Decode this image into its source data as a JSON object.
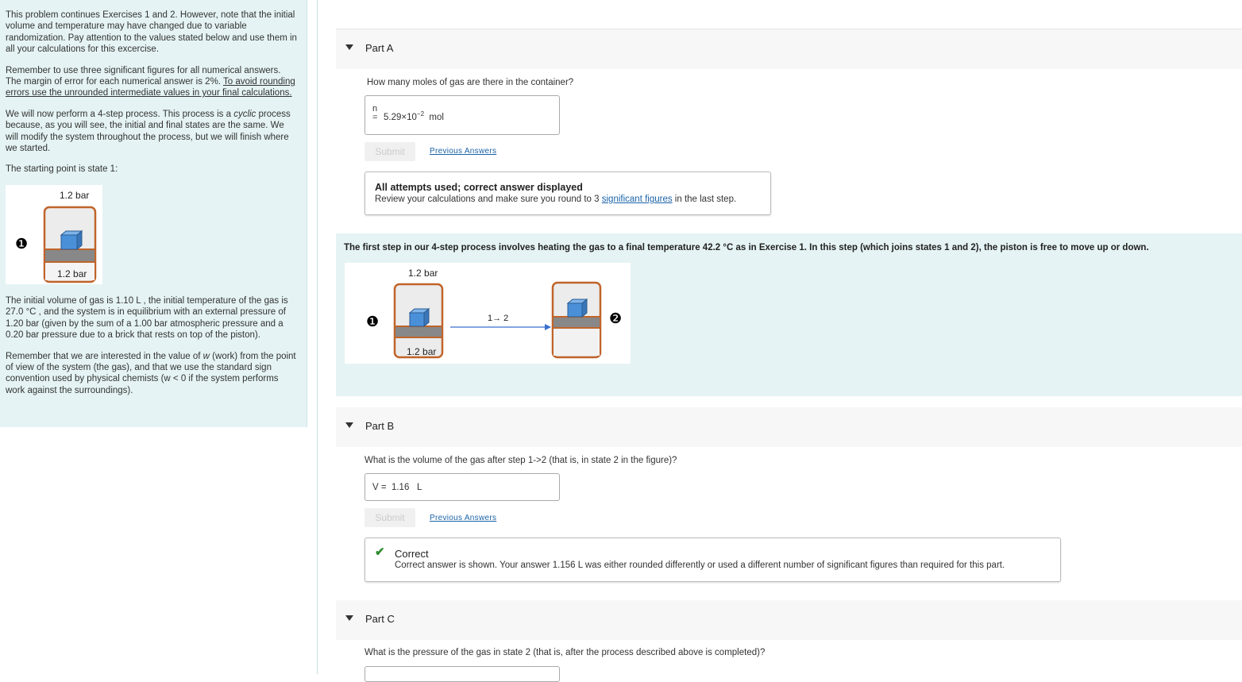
{
  "left": {
    "p1": "This problem continues Exercises 1 and 2. However, note that the initial volume and temperature may have changed due to variable randomization. Pay attention to the values stated below and use them in all your calculations for this excercise.",
    "p2_a": "Remember to use three significant figures for all numerical answers. The margin of error for each numerical answer is 2%. ",
    "p2_link": "To avoid rounding errors use the unrounded intermediate values in your final calculations.",
    "p3_a": "We will now perform a 4-step process. This process is a ",
    "p3_em": "cyclic",
    "p3_b": " process because, as you will see, the initial and final states are the same. We will modify the system throughout the process, but we will finish where we started.",
    "p4": "The starting point is state 1:",
    "fig_top_label": "1.2 bar",
    "fig_bottom_label": "1.2 bar",
    "state_marker": "❶",
    "p5": "The initial volume of gas is  1.10 L , the initial temperature of the gas is  27.0 °C , and the system is in equilibrium with an external pressure of 1.20 bar (given by the sum of a 1.00 bar atmospheric pressure and a 0.20 bar pressure due to a brick that rests on top of the piston).",
    "p6_a": "Remember that we are interested in the value of ",
    "p6_em": "w",
    "p6_b": " (work) from the point of view of the system (the gas), and that we use the standard sign convention used by physical chemists (w < 0 if the system performs work against the surroundings)."
  },
  "partA": {
    "title": "Part A",
    "question": "How many moles of gas are there in the container?",
    "var": "n",
    "eq": "=",
    "value_base": "5.29×10",
    "value_exp": "−2",
    "unit": "mol",
    "submit": "Submit",
    "prev": "Previous Answers",
    "fb_title": "All attempts used; correct answer displayed",
    "fb_a": "Review your calculations and make sure you round to 3 ",
    "fb_link": "significant figures",
    "fb_b": " in the last step."
  },
  "step": {
    "text": "The first step in our 4-step process involves heating the gas to a final temperature  42.2 °C as in Exercise 1. In this step (which joins states 1 and 2), the piston is free to move up or down.",
    "top_label": "1.2 bar",
    "bottom_label": "1.2 bar",
    "arrow_label": "1→ 2",
    "marker1": "❶",
    "marker2": "❷"
  },
  "partB": {
    "title": "Part B",
    "question": "What is the volume of the gas after step 1->2 (that is, in state 2 in the figure)?",
    "answer": "V =  1.16   L",
    "submit": "Submit",
    "prev": "Previous Answers",
    "fb_title": "Correct",
    "fb_body": "Correct answer is shown. Your answer 1.156 L was either rounded differently or used a different number of significant figures than required for this part."
  },
  "partC": {
    "title": "Part C",
    "question": "What is the pressure of the gas in state 2 (that is, after the process described above is completed)?"
  },
  "colors": {
    "panel": "#e5f3f4",
    "link": "#1a63a8",
    "cylinder": "#c0642a",
    "brick": "#4a90d9",
    "check": "#2e8b2e"
  }
}
